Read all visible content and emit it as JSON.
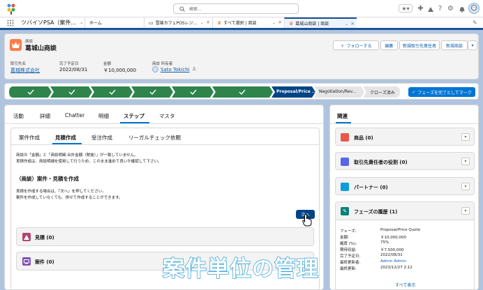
{
  "header": {
    "search_placeholder": "検索..."
  },
  "nav": {
    "app_name": "ツバイソPSA（案件...",
    "tabs": [
      {
        "label": "ホーム"
      },
      {
        "label": "雪壊カフェPOSレジ..."
      },
      {
        "label": "すべて選択 | 商談"
      },
      {
        "label": "葛城山商談 | 商談"
      }
    ]
  },
  "record": {
    "object_label": "商談",
    "title": "葛城山商談",
    "actions": {
      "follow": "フォローする",
      "edit": "編集",
      "new_contact_role": "新規取引先責任者",
      "new_opportunity": "新規商談"
    },
    "fields": [
      {
        "label": "取引先名",
        "value": "葛城株式会社"
      },
      {
        "label": "完了予定日",
        "value": "2022/08/31"
      },
      {
        "label": "金額",
        "value": "￥10,000,000"
      },
      {
        "label": "商談 所有者",
        "value": "Sato Tokichi"
      }
    ]
  },
  "path": {
    "current_stage": "Proposal/Price ...",
    "next_stages": [
      "Negotiation/Rev...",
      "クローズ済み"
    ],
    "complete_button": "フェーズを完了としてマーク"
  },
  "tabs": [
    "活動",
    "詳細",
    "Chatter",
    "明細",
    "ステップ",
    "マスタ"
  ],
  "subtabs": [
    "案件作成",
    "見積作成",
    "受注作成",
    "リーガルチェック依頼"
  ],
  "content": {
    "desc_line1": "商談の「金額」と「商談明細.合計金額（税抜）」が一致していません。",
    "desc_line2": "見積作成は、商談明細を使用して行うため、このまま進めて良いか確認して下さい。",
    "section_title": "（商談）案件・見積を作成",
    "body_line1": "見積を作成する場合は、「次へ」を押してください。",
    "body_line2": "案件を作成していなくても、併せて作成することができます。",
    "next_button": "次へ",
    "cards": [
      {
        "title": "見積 (0)"
      },
      {
        "title": "案件 (0)"
      }
    ]
  },
  "overlay_caption": "案件単位の管理",
  "related": {
    "header": "関連",
    "cards": [
      {
        "title": "商品 (0)"
      },
      {
        "title": "取引先責任者の役割 (0)"
      },
      {
        "title": "パートナー (0)"
      },
      {
        "title": "フェーズの履歴 (1)"
      }
    ],
    "history": [
      {
        "label": "フェーズ:",
        "value": "Proposal/Price Quote"
      },
      {
        "label": "金額:",
        "value": "￥10,000,000"
      },
      {
        "label": "確度 (%):",
        "value": "75%"
      },
      {
        "label": "期待収益:",
        "value": "￥7,500,000"
      },
      {
        "label": "完了予定日:",
        "value": "2022/08/31"
      },
      {
        "label": "最終更新者:",
        "value": "Admin Admin"
      },
      {
        "label": "最終更新:",
        "value": "2023/12/27 2:12"
      }
    ],
    "view_all": "すべて表示"
  },
  "colors": {
    "brand": "#0176d3",
    "nav_accent": "#1b5297",
    "complete_green": "#2e844a",
    "current_stage": "#014486"
  }
}
